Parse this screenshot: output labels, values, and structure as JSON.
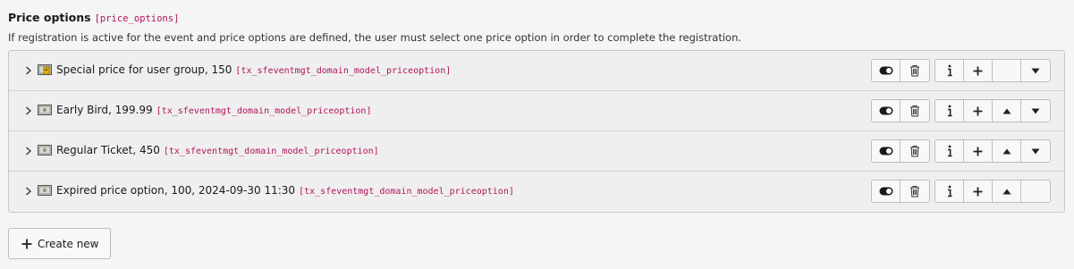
{
  "field": {
    "label": "Price options",
    "code": "[price_options]",
    "description": "If registration is active for the event and price options are defined, the user must select one price option in order to complete the registration."
  },
  "records": [
    {
      "title": "Special price for user group, 150",
      "table": "[tx_sfeventmgt_domain_model_priceoption]",
      "icon": "money-group-icon",
      "move_up": false,
      "move_down": true
    },
    {
      "title": "Early Bird, 199.99",
      "table": "[tx_sfeventmgt_domain_model_priceoption]",
      "icon": "money-icon",
      "move_up": true,
      "move_down": true
    },
    {
      "title": "Regular Ticket, 450",
      "table": "[tx_sfeventmgt_domain_model_priceoption]",
      "icon": "money-icon",
      "move_up": true,
      "move_down": true
    },
    {
      "title": "Expired price option, 100, 2024-09-30 11:30",
      "table": "[tx_sfeventmgt_domain_model_priceoption]",
      "icon": "money-icon",
      "move_up": true,
      "move_down": false
    }
  ],
  "create_button": {
    "label": "Create new"
  },
  "icons": {
    "chevron": "chevron-right-icon",
    "toggle": "toggle-icon",
    "delete": "trash-icon",
    "info": "info-icon",
    "add": "plus-icon",
    "up": "arrow-up-icon",
    "down": "arrow-down-icon"
  }
}
